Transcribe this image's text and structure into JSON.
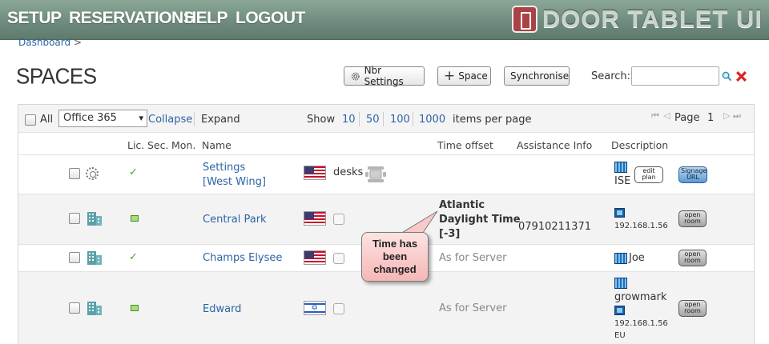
{
  "nav": {
    "items": [
      "SETUP",
      "RESERVATIONS",
      "HELP",
      "LOGOUT"
    ],
    "brand": "DOOR TABLET UI"
  },
  "breadcrumb": {
    "item": "Dashboard",
    "sep": ">"
  },
  "page": {
    "title": "SPACES"
  },
  "toolbar": {
    "nbr_settings": "Nbr Settings",
    "add_space": "Space",
    "synchronise": "Synchronise",
    "search_label": "Search:",
    "search_value": ""
  },
  "controls": {
    "all_label": "All",
    "source_selected": "Office 365",
    "collapse": "Collapse",
    "expand": "Expand",
    "show_label": "Show",
    "page_sizes": [
      "10",
      "50",
      "100",
      "1000"
    ],
    "per_page_label": "items per page",
    "page_label": "Page",
    "page_number": "1"
  },
  "columns": {
    "lic": "Lic.",
    "sec": "Sec.",
    "mon": "Mon.",
    "name": "Name",
    "time_offset": "Time offset",
    "assistance": "Assistance Info",
    "description": "Description"
  },
  "rows": [
    {
      "name_line1": "Settings",
      "name_line2": "[West Wing]",
      "desks_label": "desks",
      "desc_text": "ISE",
      "edit_plan": "edit plan",
      "signage": "Signage URL"
    },
    {
      "name": "Central Park",
      "tz_line1": "Atlantic",
      "tz_line2": "Daylight Time",
      "tz_line3": "[-3]",
      "assistance": "07910211371",
      "desc_ip": "192.168.1.56",
      "open_room": "open room"
    },
    {
      "name": "Champs Elysee",
      "time_offset": "As for Server",
      "desc_text": "Joe",
      "open_room": "open room"
    },
    {
      "name": "Edward",
      "time_offset": "As for Server",
      "desc_text": "growmark",
      "desc_ip": "192.168.1.56",
      "desc_more": "EU",
      "open_room": "open room"
    }
  ],
  "callout": {
    "line1": "Time has",
    "line2": "been",
    "line3": "changed"
  },
  "colors": {
    "topbar": "#6f8c7e",
    "link": "#2c64a3",
    "callout": "#f6b6b6",
    "check": "#4aa32a"
  }
}
